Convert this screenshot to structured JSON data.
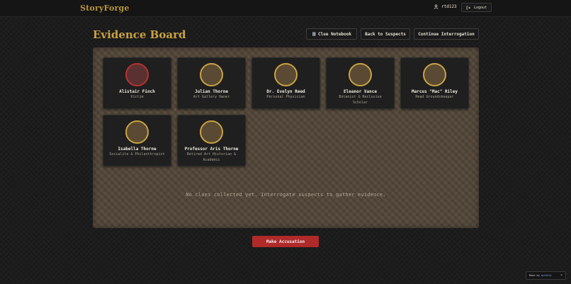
{
  "app": {
    "brand": "StoryForge"
  },
  "header": {
    "username": "rtd123",
    "logout_label": "Logout"
  },
  "page": {
    "title": "Evidence Board"
  },
  "toolbar": {
    "clue_notebook": "Clue Notebook",
    "back_to_suspects": "Back to Suspects",
    "continue_interrogation": "Continue Interrogation"
  },
  "characters": [
    {
      "name": "Alistair Finch",
      "role": "Victim",
      "status": "victim"
    },
    {
      "name": "Julian Thorne",
      "role": "Art Gallery Owner",
      "status": "suspect"
    },
    {
      "name": "Dr. Evelyn Reed",
      "role": "Personal Physician",
      "status": "suspect"
    },
    {
      "name": "Eleanor Vance",
      "role": "Botanist & Reclusive Scholar",
      "status": "suspect"
    },
    {
      "name": "Marcus \"Mac\" Riley",
      "role": "Head Groundskeeper",
      "status": "suspect"
    },
    {
      "name": "Isabella Thorne",
      "role": "Socialite & Philanthropist",
      "status": "suspect"
    },
    {
      "name": "Professor Aris Thorne",
      "role": "Retired Art Historian & Academic",
      "status": "suspect"
    }
  ],
  "evidence": {
    "empty_message": "No clues collected yet. Interrogate suspects to gather evidence."
  },
  "actions": {
    "accuse_label": "Make Accusation"
  },
  "footer": {
    "made_by_prefix": "Made by",
    "made_by_name": "qithelo",
    "close_symbol": "×"
  },
  "colors": {
    "accent_gold": "#c9a243",
    "victim_red": "#b83232",
    "accuse_red": "#b02a2a"
  }
}
